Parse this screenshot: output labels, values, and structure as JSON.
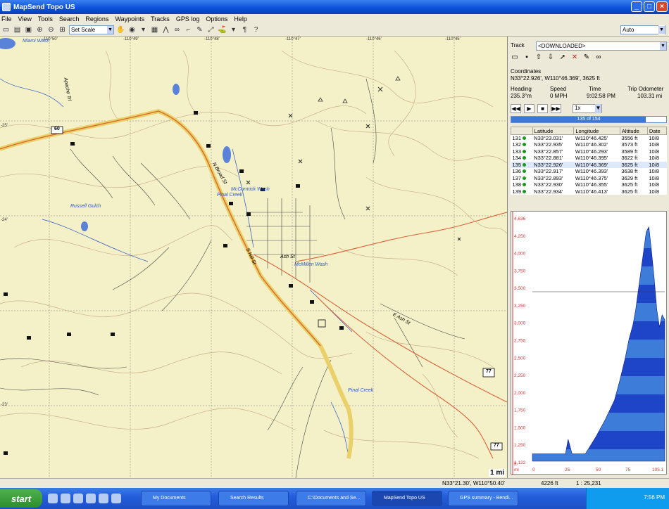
{
  "window": {
    "title": "MapSend Topo US",
    "min": "_",
    "max": "□",
    "close": "×"
  },
  "menu": [
    "File",
    "View",
    "Tools",
    "Search",
    "Regions",
    "Waypoints",
    "Tracks",
    "GPS log",
    "Options",
    "Help"
  ],
  "toolbar": {
    "scale_value": "Set Scale",
    "zoom_value": "Auto"
  },
  "map": {
    "labels": {
      "miami_wash": "Miami Wash",
      "apache_trail": "Apache Trl",
      "mccormick_wash": "McCormick Wash",
      "pinal_creek_north": "Pinal Creek",
      "russell_gulch": "Russell Gulch",
      "mcmillen_wash": "McMillen Wash",
      "pinal_creek_south": "Pinal Creek",
      "ash_st": "Ash St",
      "s_broad_st": "N Broad St",
      "s_hill_st": "S Hill St",
      "e_ash_st": "E Ash St"
    },
    "coords": {
      "top": [
        "-110°50'",
        "-110°49'",
        "-110°48'",
        "-110°47'",
        "-110°46'",
        "-110°45'"
      ],
      "left": [
        "-25'",
        "-24'",
        "-23'"
      ]
    },
    "shields": {
      "us60": "60",
      "az77": "77",
      "az77b": "77"
    },
    "scale_label": "1 mi"
  },
  "panel": {
    "track_label": "Track",
    "track_value": "<DOWNLOADED>",
    "coordinates_label": "Coordinates",
    "coordinates_value": "N33°22.926', W110°46.369', 3625 ft",
    "heading_label": "Heading",
    "speed_label": "Speed",
    "time_label": "Time",
    "odometer_label": "Trip Odometer",
    "heading_value": "235.3°m",
    "speed_value": "0 MPH",
    "time_value": "9:02:58 PM",
    "odometer_value": "103.31 mi",
    "speed_multiplier": "1x",
    "progress_text": "135 of 154",
    "progress": 0.87,
    "table": {
      "headers": [
        "",
        "Latitude",
        "Longitude",
        "Altitude",
        "Date"
      ],
      "rows": [
        {
          "id": "131",
          "lat": "N33°23.031'",
          "lon": "W110°46.425'",
          "alt": "3556 ft",
          "date": "10/8"
        },
        {
          "id": "132",
          "lat": "N33°22.935'",
          "lon": "W110°46.302'",
          "alt": "3573 ft",
          "date": "10/8"
        },
        {
          "id": "133",
          "lat": "N33°22.857'",
          "lon": "W110°46.293'",
          "alt": "3589 ft",
          "date": "10/8"
        },
        {
          "id": "134",
          "lat": "N33°22.881'",
          "lon": "W110°46.395'",
          "alt": "3622 ft",
          "date": "10/8"
        },
        {
          "id": "135",
          "lat": "N33°22.926'",
          "lon": "W110°46.369'",
          "alt": "3625 ft",
          "date": "10/8"
        },
        {
          "id": "136",
          "lat": "N33°22.917'",
          "lon": "W110°46.393'",
          "alt": "3638 ft",
          "date": "10/8"
        },
        {
          "id": "137",
          "lat": "N33°22.893'",
          "lon": "W110°46.375'",
          "alt": "3629 ft",
          "date": "10/8"
        },
        {
          "id": "138",
          "lat": "N33°22.930'",
          "lon": "W110°46.355'",
          "alt": "3625 ft",
          "date": "10/8"
        },
        {
          "id": "139",
          "lat": "N33°22.934'",
          "lon": "W110°46.413'",
          "alt": "3625 ft",
          "date": "10/8"
        }
      ]
    },
    "profile": {
      "y_ticks": [
        "4,636",
        "4,250",
        "4,000",
        "3,750",
        "3,500",
        "3,250",
        "3,000",
        "2,750",
        "2,500",
        "2,250",
        "2,000",
        "1,750",
        "1,500",
        "1,250",
        "1,122"
      ],
      "x_ticks": [
        "mi",
        "0",
        "25",
        "50",
        "75",
        "105.1"
      ],
      "y_unit": "ft"
    }
  },
  "status": {
    "coords": "N33°21.30', W110°50.40'",
    "elev": "4226 ft",
    "scale": "1 : 25,231"
  },
  "taskbar": {
    "start": "start",
    "tasks": [
      "My Documents",
      "Search Results",
      "C:\\Documents and Se...",
      "MapSend Topo US",
      "GPS summary - Bendi..."
    ],
    "clock": "7:56 PM"
  },
  "colors": {
    "map_bg": "#f4f1c8",
    "track": "#f0c020",
    "road": "#d9633a",
    "water": "#2a56c8",
    "profile_fill": "#1e44c8"
  }
}
